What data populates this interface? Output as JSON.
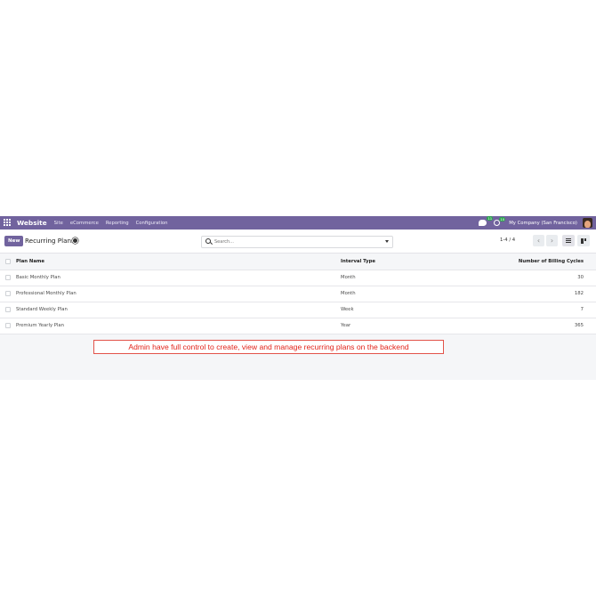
{
  "navbar": {
    "brand": "Website",
    "menu": [
      "Site",
      "eCommerce",
      "Reporting",
      "Configuration"
    ],
    "chat_badge": "11",
    "activity_badge": "10",
    "company": "My Company (San Francisco)"
  },
  "control": {
    "new_label": "New",
    "breadcrumb": "Recurring Plans",
    "search_placeholder": "Search...",
    "pager": "1-4 / 4"
  },
  "table": {
    "columns": [
      "Plan Name",
      "Interval Type",
      "Number of Billing Cycles"
    ],
    "rows": [
      {
        "name": "Basic Monthly Plan",
        "interval": "Month",
        "cycles": "30"
      },
      {
        "name": "Professional Monthly Plan",
        "interval": "Month",
        "cycles": "182"
      },
      {
        "name": "Standard Weekly Plan",
        "interval": "Week",
        "cycles": "7"
      },
      {
        "name": "Premium Yearly Plan",
        "interval": "Year",
        "cycles": "365"
      }
    ]
  },
  "note": "Admin have full control to create, view and manage recurring plans on the backend",
  "colors": {
    "brand": "#71639e",
    "annotation": "#e2231a"
  }
}
